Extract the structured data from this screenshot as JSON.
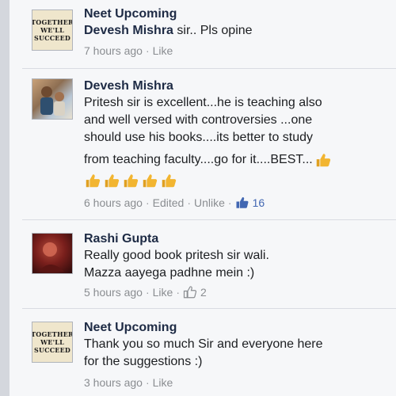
{
  "comments": [
    {
      "author": "Neet Upcoming",
      "avatar_lines": [
        "Together",
        "We'll",
        "Succeed"
      ],
      "text_author_inline": "Devesh Mishra",
      "text": "sir..  Pls opine",
      "time": "7 hours ago",
      "like_label": "Like"
    },
    {
      "author": "Devesh Mishra",
      "lines": [
        "Pritesh sir is excellent...he is teaching also",
        "and well versed with controversies ...one",
        "should use his books....its better to study",
        "from teaching faculty....go for it....BEST..."
      ],
      "time": "6 hours ago",
      "edited": "Edited",
      "unlike_label": "Unlike",
      "like_count": "16"
    },
    {
      "author": "Rashi Gupta",
      "lines": [
        "Really good book pritesh sir wali.",
        "Mazza aayega padhne mein :)"
      ],
      "time": "5 hours ago",
      "like_label": "Like",
      "like_count": "2"
    },
    {
      "author": "Neet Upcoming",
      "avatar_lines": [
        "Together",
        "We'll",
        "Succeed"
      ],
      "lines": [
        "Thank you so much Sir and everyone here",
        "for the suggestions :)"
      ],
      "time": "3 hours ago",
      "like_label": "Like"
    }
  ],
  "colors": {
    "author": "#1d2a44",
    "meta": "#8a8d91",
    "like_blue": "#4267b2",
    "thumb_yellow": "#f2b531"
  },
  "icons": [
    "thumbs-up-icon",
    "thumbs-up-emoji-icon"
  ]
}
